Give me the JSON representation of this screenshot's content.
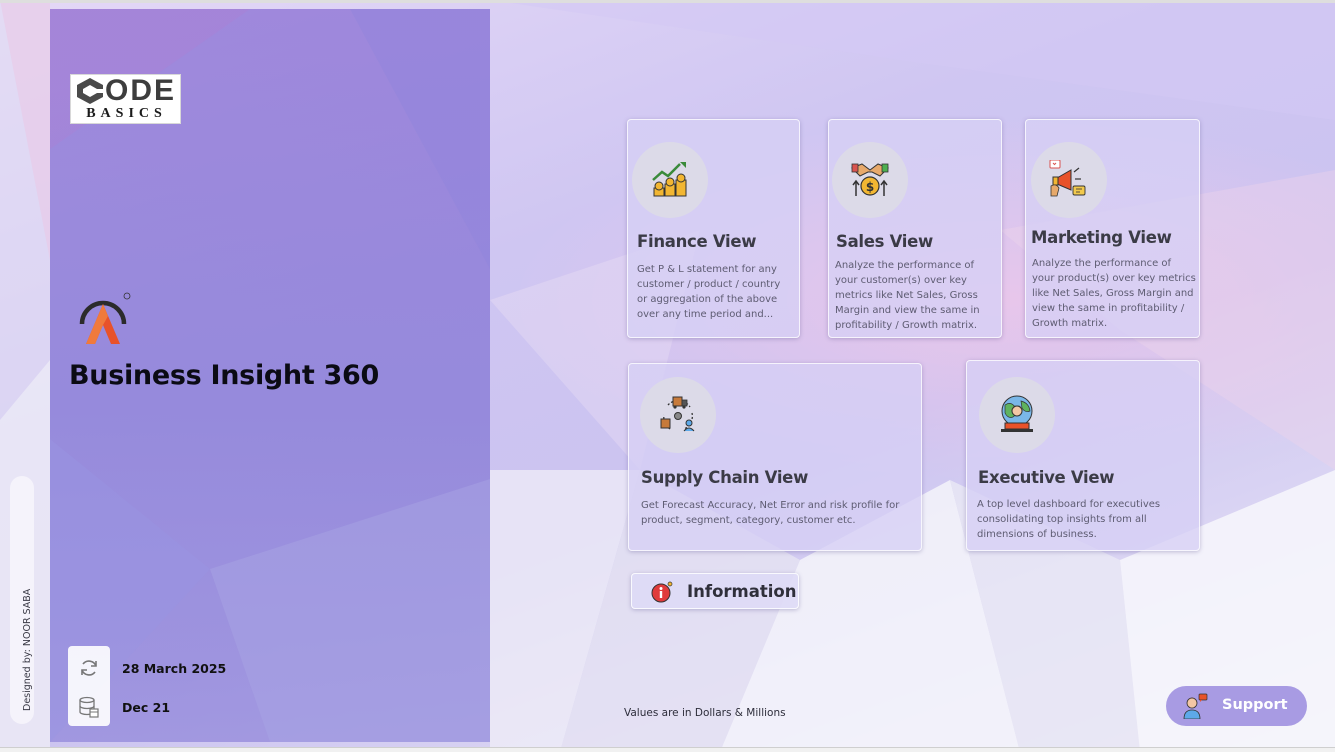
{
  "brand": {
    "logo_top": "ODE",
    "logo_bottom": "BASICS",
    "app_title": "Business Insight 360"
  },
  "designer_credit": "Designed by: NOOR SABA",
  "meta": {
    "last_refresh": "28 March 2025",
    "data_until": "Dec 21"
  },
  "cards": {
    "finance": {
      "title": "Finance View",
      "description": "Get P & L statement for any customer / product / country or aggregation of the above over any time period and...",
      "icon": "finance-growth-icon"
    },
    "sales": {
      "title": "Sales View",
      "description": "Analyze the performance of your customer(s) over key metrics like Net Sales, Gross Margin and view the same in profitability / Growth matrix.",
      "icon": "handshake-dollar-icon"
    },
    "marketing": {
      "title": "Marketing View",
      "description": "Analyze the performance of your product(s) over key metrics like Net Sales, Gross Margin and view the same in profitability / Growth matrix.",
      "icon": "megaphone-icon"
    },
    "supply_chain": {
      "title": "Supply Chain View",
      "description": "Get Forecast Accuracy, Net Error and risk profile for product, segment, category, customer etc.",
      "icon": "supply-chain-icon"
    },
    "executive": {
      "title": "Executive View",
      "description": "A top level dashboard for executives consolidating top insights from all dimensions of business.",
      "icon": "executive-globe-icon"
    }
  },
  "information": {
    "label": "Information"
  },
  "footnote": "Values are in Dollars & Millions",
  "support": {
    "label": "Support"
  },
  "colors": {
    "panel": "#9178d6",
    "card_bg": "#d6d0f5",
    "support_bg": "#a89be3",
    "title_text": "#0b0b14"
  }
}
